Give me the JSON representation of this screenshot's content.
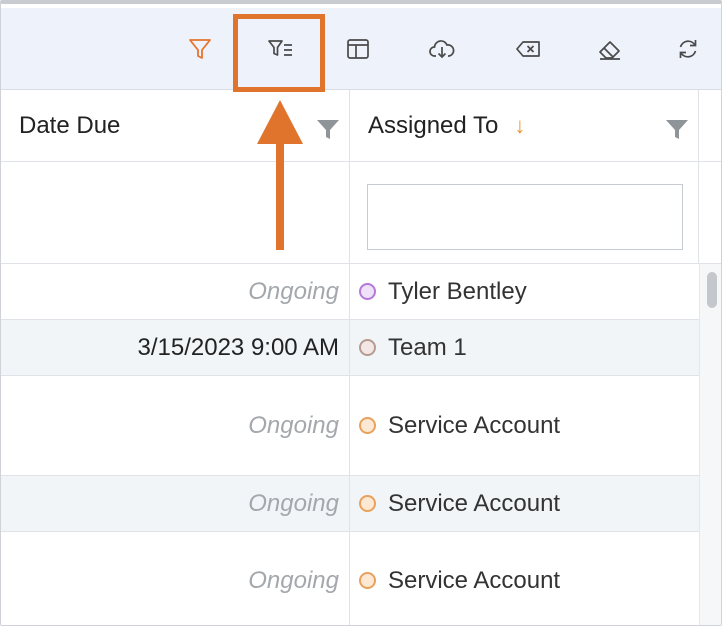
{
  "toolbar": {
    "icons": [
      {
        "name": "filter-icon",
        "color": "#e8742c"
      },
      {
        "name": "filter-list-icon"
      },
      {
        "name": "column-layout-icon"
      },
      {
        "name": "cloud-download-icon"
      },
      {
        "name": "clear-input-icon"
      },
      {
        "name": "eraser-icon"
      },
      {
        "name": "refresh-icon"
      }
    ],
    "highlight_color": "#e0742c"
  },
  "columns": [
    {
      "label": "Date Due"
    },
    {
      "label": "Assigned To",
      "sort": "↓"
    }
  ],
  "filter": {
    "assigned_to_value": ""
  },
  "rows": [
    {
      "date": "Ongoing",
      "assignee": "Tyler Bentley",
      "dot_color": "#b57ad9",
      "dot_fill": "#efe2f8"
    },
    {
      "date": "3/15/2023 9:00 AM",
      "assignee": "Team 1",
      "dot_color": "#b59b92",
      "dot_fill": "#f2e7e4"
    },
    {
      "date": "Ongoing",
      "assignee": "Service Account",
      "dot_color": "#e8a25c",
      "dot_fill": "#fde9d3"
    },
    {
      "date": "Ongoing",
      "assignee": "Service Account",
      "dot_color": "#e8a25c",
      "dot_fill": "#fde9d3"
    },
    {
      "date": "Ongoing",
      "assignee": "Service Account",
      "dot_color": "#e8a25c",
      "dot_fill": "#fde9d3"
    }
  ],
  "colors": {
    "accent": "#e0742c",
    "sort_arrow": "#e8942a",
    "muted_text": "#a4a8ad"
  }
}
